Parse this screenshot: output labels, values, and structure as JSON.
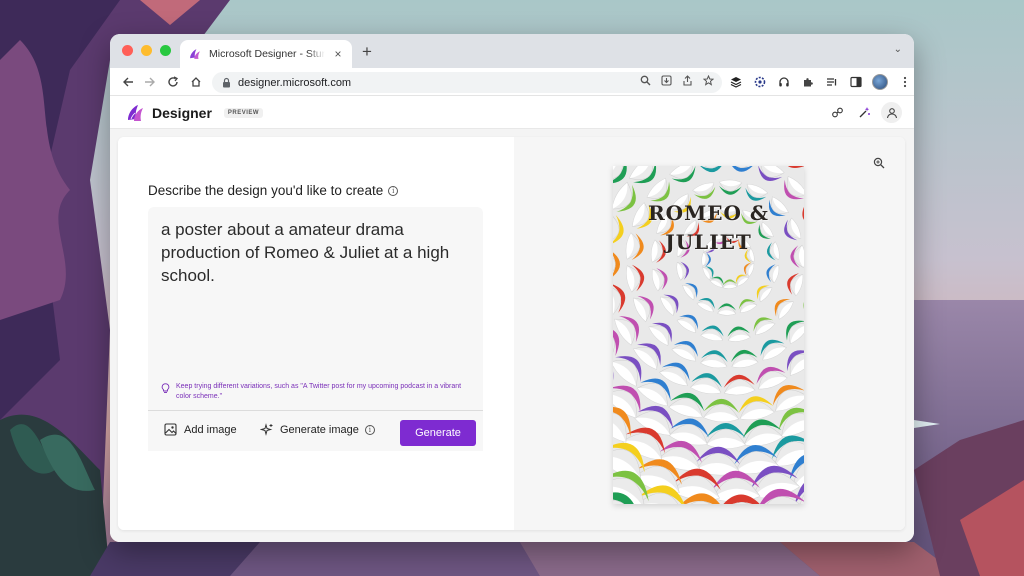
{
  "browser": {
    "tab_title": "Microsoft Designer - Stunning designs in a flash",
    "url": "designer.microsoft.com",
    "new_tab": "+",
    "close_tab": "×",
    "tab_menu": "⌄"
  },
  "app": {
    "name": "Designer",
    "badge": "PREVIEW",
    "accent": "#7e2bd1"
  },
  "prompt": {
    "heading": "Describe the design you'd like to create",
    "text": "a poster about a amateur drama production of Romeo & Juliet at a high school.",
    "hint": "Keep trying different variations, such as \"A Twitter post for my upcoming podcast in a vibrant color scheme.\"",
    "add_image_label": "Add image",
    "generate_image_label": "Generate image",
    "generate_button_label": "Generate"
  },
  "preview": {
    "poster_title": "ROMEO &\nJULIET"
  },
  "icons": {
    "back": "arrow-left-icon",
    "forward": "arrow-right-icon",
    "reload": "reload-icon",
    "home": "home-icon",
    "lock": "lock-icon",
    "zoom": "zoom-icon",
    "hint": "lightbulb-icon"
  }
}
